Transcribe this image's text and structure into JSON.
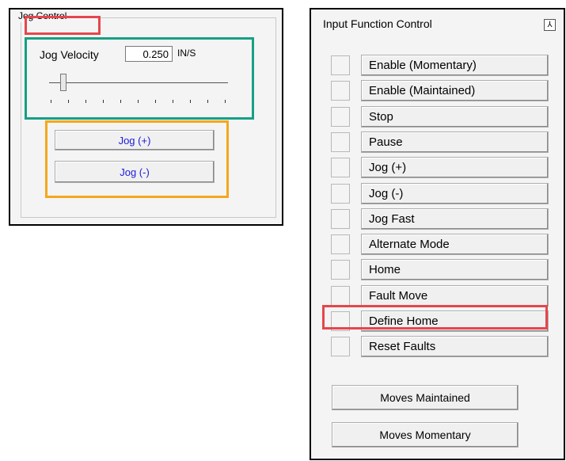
{
  "jog_control": {
    "title": "Jog Control",
    "velocity_label": "Jog Velocity",
    "velocity_value": "0.250",
    "velocity_unit": "IN/S",
    "slider_level": 0.08,
    "jog_plus_label": "Jog (+)",
    "jog_minus_label": "Jog (-)"
  },
  "input_function_control": {
    "title": "Input Function Control",
    "collapse_glyph": "⅄",
    "functions": [
      {
        "label": "Enable (Momentary)"
      },
      {
        "label": "Enable (Maintained)"
      },
      {
        "label": "Stop"
      },
      {
        "label": "Pause"
      },
      {
        "label": "Jog (+)"
      },
      {
        "label": "Jog (-)"
      },
      {
        "label": "Jog Fast"
      },
      {
        "label": "Alternate Mode"
      },
      {
        "label": "Home"
      },
      {
        "label": "Fault Move"
      },
      {
        "label": "Define Home"
      },
      {
        "label": "Reset Faults"
      }
    ],
    "moves_maintained_label": "Moves Maintained",
    "moves_momentary_label": "Moves Momentary"
  },
  "colors": {
    "highlight_red": "#e5464c",
    "highlight_green": "#16a085",
    "highlight_orange": "#f4a81d",
    "jog_button_text": "#1a1adb"
  }
}
